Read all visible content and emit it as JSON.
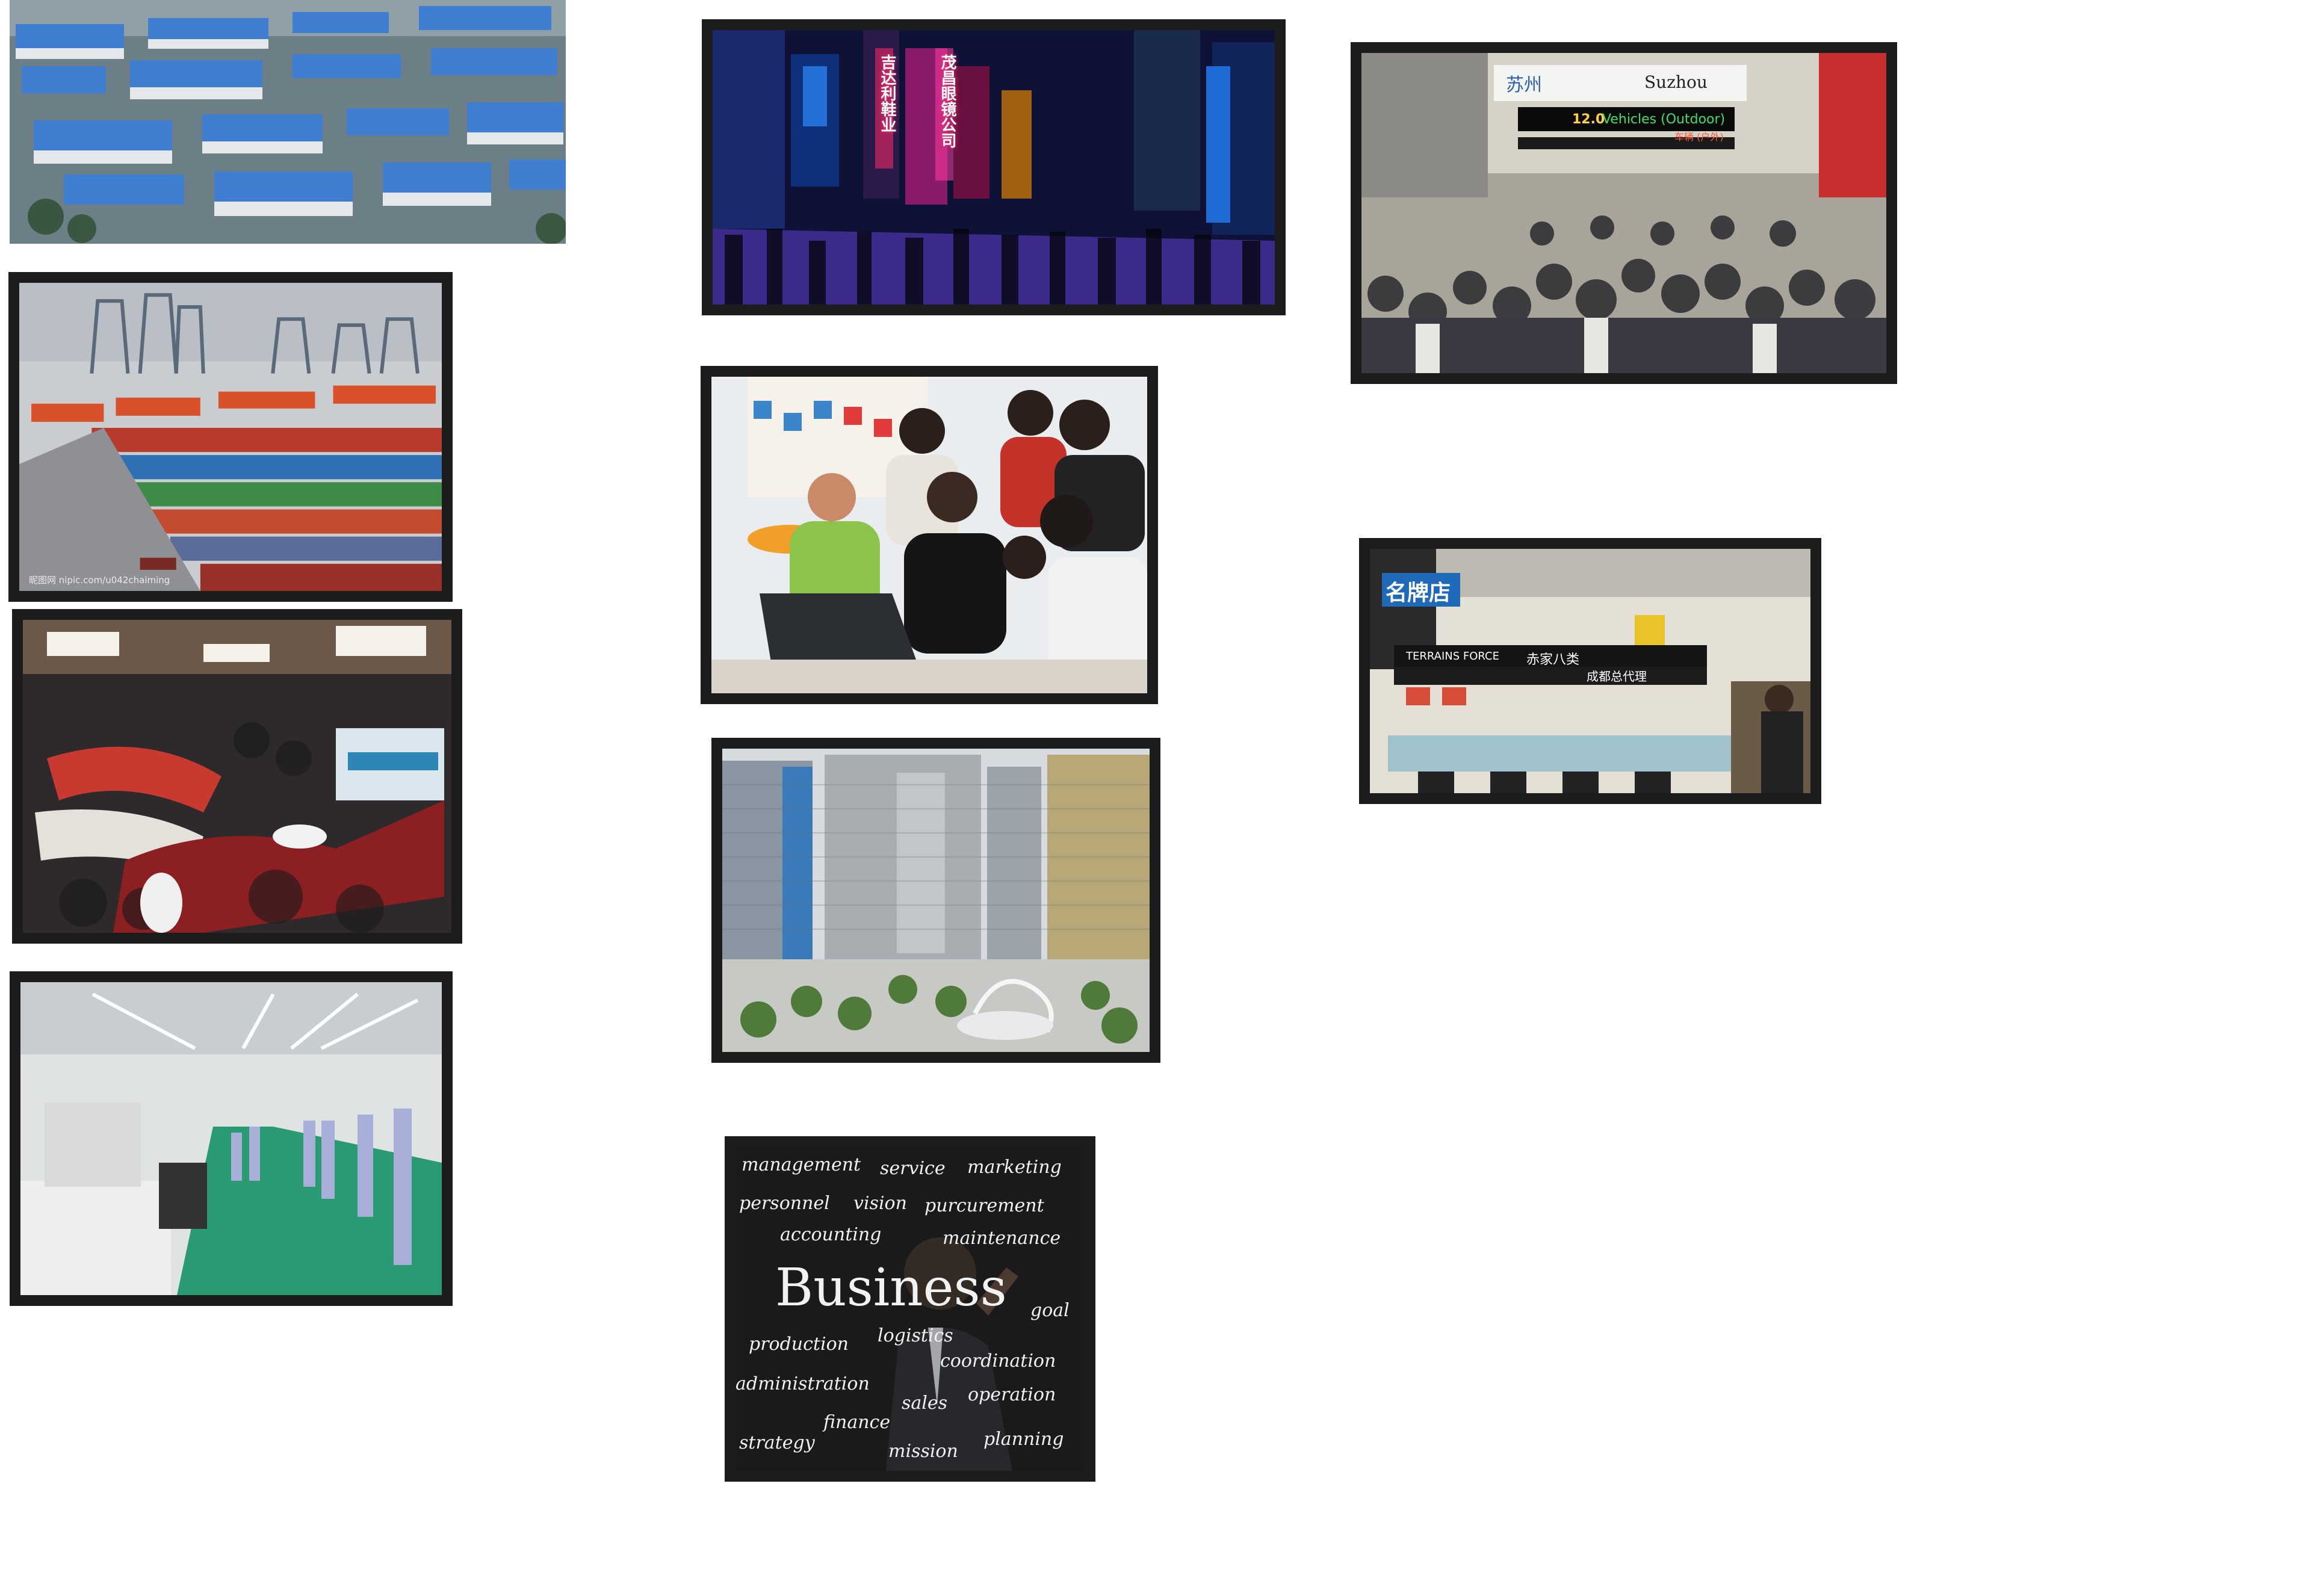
{
  "collage": {
    "container_watermark": "昵图网 nipic.com/u042chaiming",
    "nanjing_road_signs": [
      "吉达利鞋业",
      "茂昌眼镜公司"
    ],
    "trade_fair_sign": {
      "city_cn": "苏州",
      "city_en": "Suzhou",
      "hall": "12.0",
      "hall_label": "Vehicles (Outdoor)",
      "hall_label_cn": "车辆 (户外)"
    },
    "mall_signs": {
      "brand_left": "名牌店",
      "brand_strip": "TERRAINS FORCE",
      "strip_cn_1": "赤家八类",
      "strip_cn_2": "成都总代理"
    },
    "business_board": {
      "words": [
        "management",
        "service",
        "marketing",
        "personnel",
        "vision",
        "purcurement",
        "accounting",
        "maintenance",
        "Business",
        "goal",
        "production",
        "logistics",
        "coordination",
        "administration",
        "sales",
        "operation",
        "finance",
        "strategy",
        "mission",
        "planning"
      ]
    }
  },
  "colors": {
    "frame": "#1c1c1c",
    "page": "#ffffff",
    "roof_blue": "#3f7ed0",
    "neon_pink": "#ff2a6a",
    "chalkboard": "#151515",
    "factory_floor": "#2a9a72"
  },
  "photos": [
    {
      "id": "industrial-park",
      "kind": "aerial view of industrial park with blue roofs"
    },
    {
      "id": "container-port",
      "kind": "container terminal with cranes"
    },
    {
      "id": "exhibition-hall",
      "kind": "crowded electronics exhibition booths from above"
    },
    {
      "id": "factory-floor",
      "kind": "factory production line with workers"
    },
    {
      "id": "nanjing-road",
      "kind": "night shopping street with neon signs"
    },
    {
      "id": "business-meeting",
      "kind": "group looking at laptop at trade booth"
    },
    {
      "id": "office-towers",
      "kind": "aerial view of office towers and plaza"
    },
    {
      "id": "business-chalkboard",
      "kind": "businessman writing word cloud on chalkboard"
    },
    {
      "id": "trade-fair-crowd",
      "kind": "crowded trade fair hall"
    },
    {
      "id": "electronics-mall",
      "kind": "electronics retail mall counters"
    }
  ]
}
